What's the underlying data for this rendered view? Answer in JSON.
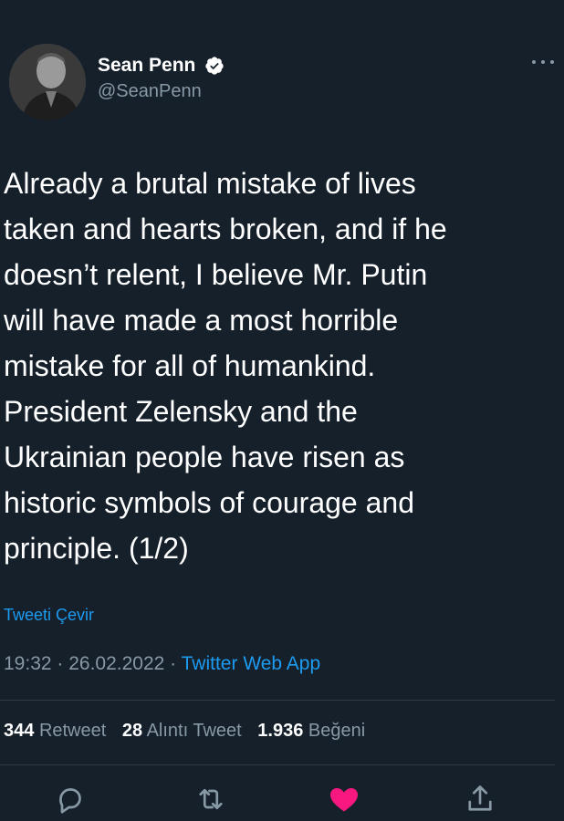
{
  "tweet": {
    "author": {
      "display_name": "Sean Penn",
      "handle": "@SeanPenn",
      "verified": true
    },
    "text": "Already a brutal mistake of lives\ntaken and hearts broken, and if he\ndoesn’t relent, I believe Mr. Putin\nwill have made a most horrible\nmistake for all of humankind.\nPresident Zelensky and the\nUkrainian people have risen as\nhistoric symbols of courage and\nprinciple. (1/2)",
    "translate_label": "Tweeti Çevir",
    "time": "19:32",
    "separator": " · ",
    "date": "26.02.2022",
    "source": "Twitter Web App",
    "stats": {
      "retweets": "344",
      "retweets_label": "Retweet",
      "quotes": "28",
      "quotes_label": "Alıntı Tweet",
      "likes": "1.936",
      "likes_label": "Beğeni"
    }
  },
  "icons": {
    "more": "more-horizontal-icon",
    "reply": "reply-icon",
    "retweet": "retweet-icon",
    "like": "heart-icon",
    "share": "share-icon"
  },
  "colors": {
    "background": "#15202b",
    "accent": "#1d9bf0",
    "like": "#f91880",
    "secondary_text": "#8899a6"
  }
}
